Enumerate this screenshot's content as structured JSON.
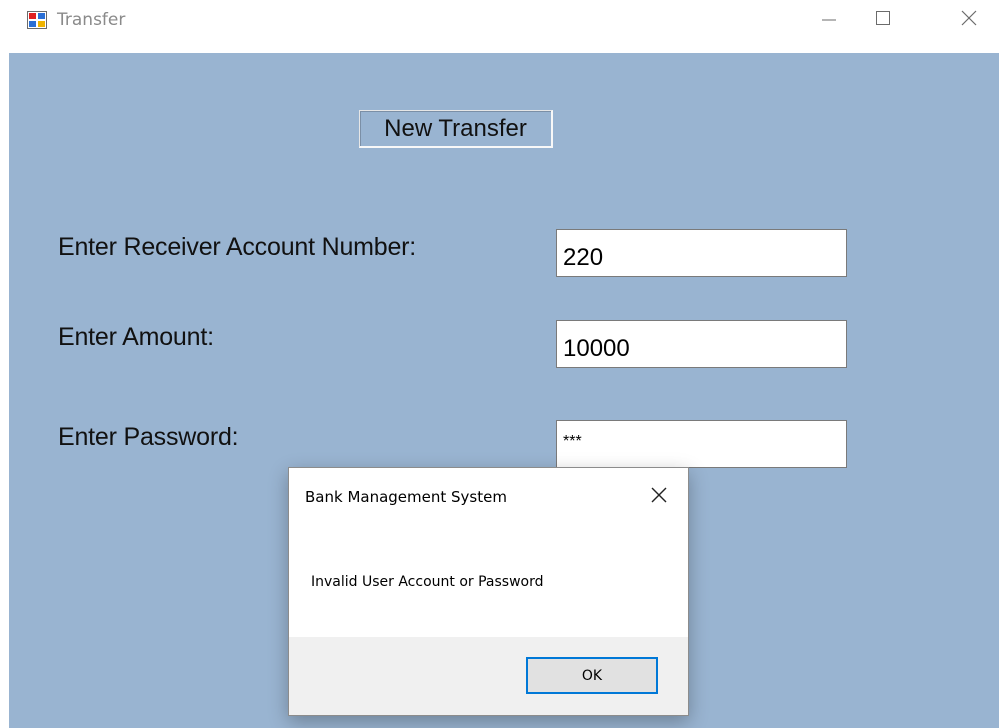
{
  "window": {
    "title": "Transfer",
    "icon": "app-window-icon",
    "controls": [
      "minimize-icon",
      "maximize-icon",
      "close-icon"
    ]
  },
  "form": {
    "header_button_label": "New Transfer",
    "account_label": "Enter Receiver Account Number:",
    "account_value": "220",
    "amount_label": "Enter Amount:",
    "amount_value": "10000",
    "password_label": "Enter Password:",
    "password_value": "***"
  },
  "dialog": {
    "title": "Bank Management System",
    "message": "Invalid User Account or Password",
    "ok_label": "OK"
  },
  "colors": {
    "client_background": "#99b4d1",
    "dialog_footer": "#f0f0f0",
    "ok_button_border": "#0078d7"
  }
}
